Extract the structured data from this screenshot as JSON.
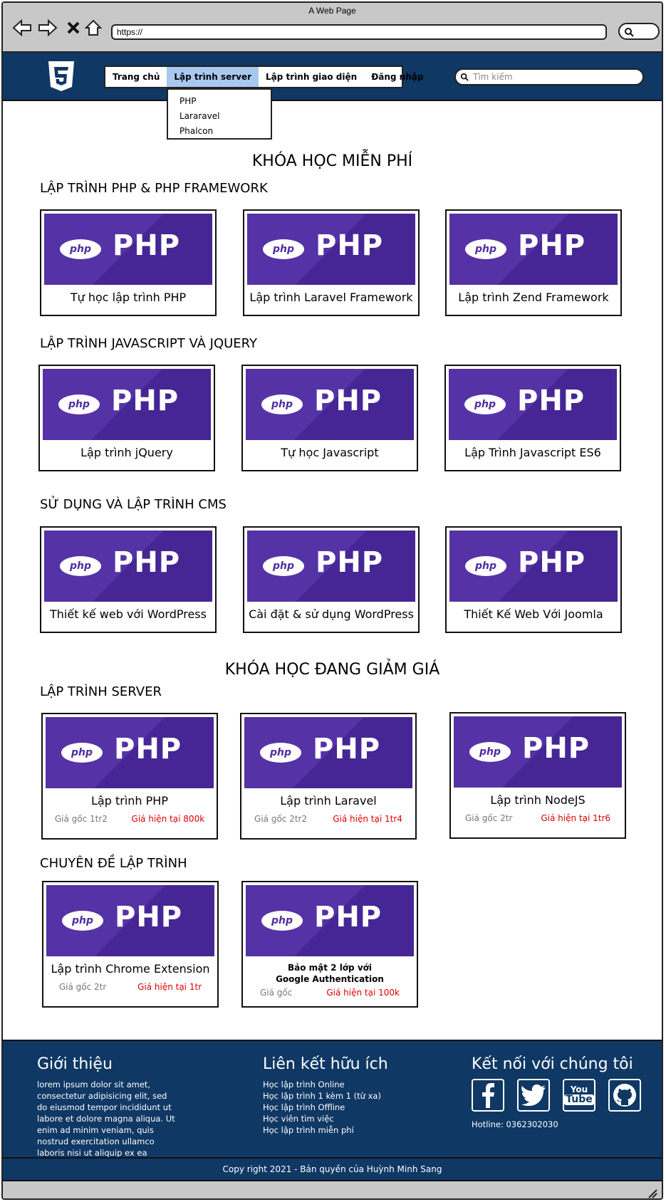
{
  "browser": {
    "title": "A Web Page",
    "url": "https://"
  },
  "header": {
    "menu": [
      "Trang chủ",
      "Lập trình server",
      "Lập trình giao diện",
      "Đăng nhập"
    ],
    "search_placeholder": "Tìm kiếm",
    "dropdown": [
      "PHP",
      "Lararavel",
      "Phalcon"
    ]
  },
  "free": {
    "heading": "KHÓA HỌC MIỄN PHÍ",
    "sections": [
      {
        "title": "LẬP TRÌNH PHP & PHP FRAMEWORK",
        "courses": [
          "Tự học lập trình PHP",
          "Lập trình Laravel Framework",
          "Lập trình Zend Framework"
        ]
      },
      {
        "title": "LẬP TRÌNH JAVASCRIPT VÀ JQUERY",
        "courses": [
          "Lập trình jQuery",
          "Tự học Javascript",
          "Lập Trình Javascript ES6"
        ]
      },
      {
        "title": "SỬ DỤNG VÀ LẬP TRÌNH CMS",
        "courses": [
          "Thiết kế web với WordPress",
          "Cài đặt & sử dụng WordPress",
          "Thiết Kế Web Với Joomla"
        ]
      }
    ]
  },
  "sale": {
    "heading": "KHÓA HỌC ĐANG GIẢM GIÁ",
    "sections": [
      {
        "title": "LẬP TRÌNH SERVER",
        "courses": [
          {
            "name": "Lập trình PHP",
            "old": "Giá gốc 1tr2",
            "now": "Giá hiện tại 800k"
          },
          {
            "name": "Lập trình Laravel",
            "old": "Giá gốc 2tr2",
            "now": "Giá hiện tại 1tr4"
          },
          {
            "name": "Lập trình NodeJS",
            "old": "Giá gốc 2tr",
            "now": "Giá hiện tại 1tr6"
          }
        ]
      },
      {
        "title": "CHUYÊN ĐỀ LẬP TRÌNH",
        "courses": [
          {
            "name": "Lập trình Chrome Extension",
            "old": "Giá gốc 2tr",
            "now": "Giá hiện tại 1tr"
          },
          {
            "name_line1": "Bảo mật 2 lớp với",
            "name_line2": "Google Authentication",
            "old": "Giá gốc",
            "now": "Giá hiện tại 100k"
          }
        ]
      }
    ]
  },
  "thumb_label": "PHP",
  "thumb_badge": "php",
  "footer": {
    "about_title": "Giới thiệu",
    "about_text": "lorem ipsum dolor sit amet, consectetur adipisicing elit, sed do eiusmod tempor incididunt ut labore et dolore magna aliqua. Ut enim ad minim veniam, quis nostrud exercitation ullamco laboris nisi ut aliquip ex ea",
    "links_title": "Liên kết hữu ích",
    "links": [
      "Học lập trình Online",
      "Học lập trình 1 kèm 1 (từ xa)",
      "Học lập trình Offline",
      "Học viên tìm việc",
      "Học lập trình miễn phí"
    ],
    "connect_title": "Kết nối với chúng tôi",
    "social_icons": [
      "facebook-icon",
      "twitter-icon",
      "youtube-icon",
      "github-icon"
    ],
    "youtube_line1": "You",
    "youtube_line2": "Tube",
    "hotline": "Hotline: 0362302030",
    "copyright": "Copy right 2021 - Bản quyền của Huỳnh Minh Sang"
  },
  "colors": {
    "navy": "#0f3864",
    "php_purple": "#4f2ea0",
    "price_now": "#dd0000",
    "menu_active": "#a9c8f0"
  }
}
